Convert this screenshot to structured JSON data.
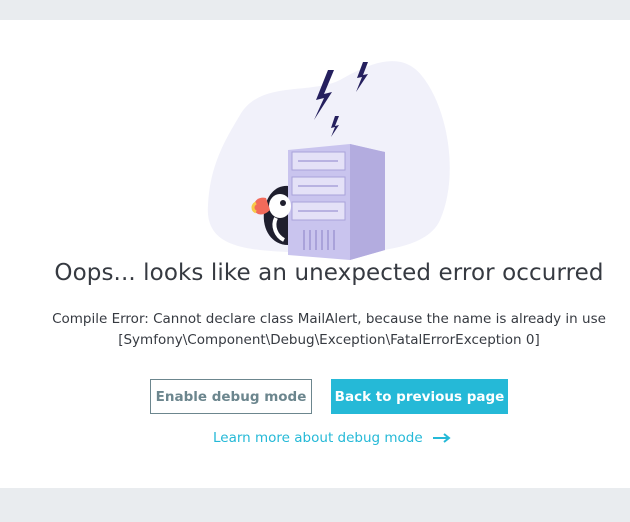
{
  "error": {
    "title": "Oops... looks like an unexpected error occurred",
    "message_line1": "Compile Error: Cannot declare class MailAlert, because the name is already in use",
    "message_line2": "[Symfony\\Component\\Debug\\Exception\\FatalErrorException 0]"
  },
  "actions": {
    "enable_debug_label": "Enable debug mode",
    "back_label": "Back to previous page",
    "learn_more_label": "Learn more about debug mode"
  },
  "colors": {
    "accent": "#25b9d7",
    "outline": "#6c868e",
    "text": "#363a41",
    "server": "#c2bde6",
    "bolt": "#25205e",
    "blob": "#f1f1fa"
  },
  "icons": {
    "illustration": "error-server-puffin-illustration",
    "arrow": "arrow-right-icon"
  }
}
